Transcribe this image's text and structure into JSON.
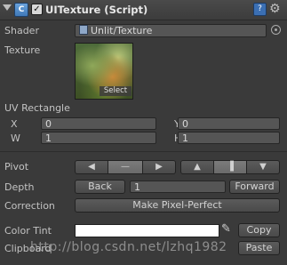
{
  "header": {
    "component_icon": "unity-component-icon",
    "checked_mark": "✓",
    "title": "UITexture (Script)",
    "help_icon": "help-book-icon",
    "help_glyph": "?",
    "gear_icon": "gear-icon",
    "gear_glyph": "⚙"
  },
  "shader": {
    "label": "Shader",
    "value": "Unlit/Texture"
  },
  "texture": {
    "label": "Texture",
    "select_label": "Select"
  },
  "uv": {
    "label": "UV Rectangle",
    "x_label": "X",
    "x_value": "0",
    "y_label": "Y",
    "y_value": "0",
    "w_label": "W",
    "w_value": "1",
    "h_label": "H",
    "h_value": "1"
  },
  "pivot": {
    "label": "Pivot",
    "horizontal": [
      "◀",
      "—",
      "▶"
    ],
    "vertical": [
      "▲",
      "▐",
      "▼"
    ]
  },
  "depth": {
    "label": "Depth",
    "back_label": "Back",
    "value": "1",
    "forward_label": "Forward"
  },
  "correction": {
    "label": "Correction",
    "button_label": "Make Pixel-Perfect"
  },
  "color_tint": {
    "label": "Color Tint",
    "color": "#ffffff",
    "copy_label": "Copy"
  },
  "clipboard": {
    "label": "Clipboard",
    "paste_label": "Paste"
  },
  "watermark": "http://blog.csdn.net/lzhq1982"
}
